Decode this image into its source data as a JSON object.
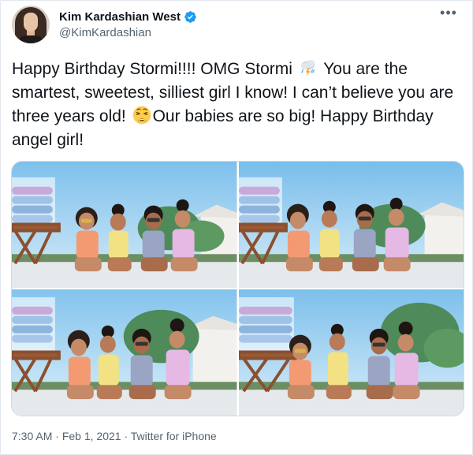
{
  "author": {
    "display_name": "Kim Kardashian West",
    "handle": "@KimKardashian",
    "verified": true
  },
  "tweet": {
    "text_part1": "Happy Birthday Stormi!!!! OMG Stormi ",
    "emoji1": "cloud-with-lightning-and-rain",
    "text_part2": " You are the smartest, sweetest, silliest girl I know! I can’t believe you are three years old! ",
    "emoji2": "weary-face",
    "text_part3": "Our babies are so big! Happy Birthday angel girl!"
  },
  "media": {
    "photos": [
      {
        "alt_icon": "photo"
      },
      {
        "alt_icon": "photo"
      },
      {
        "alt_icon": "photo"
      },
      {
        "alt_icon": "photo"
      }
    ]
  },
  "meta": {
    "time": "7:30 AM",
    "separator1": " · ",
    "date": "Feb 1, 2021",
    "separator2": " · ",
    "source": "Twitter for iPhone"
  },
  "colors": {
    "verified": "#1d9bf0",
    "secondary_text": "#536471",
    "sky": "#8cc7ee",
    "sky_light": "#cfe8f8"
  },
  "icons": {
    "verified": "verified-badge-icon",
    "more": "more-options-icon"
  }
}
